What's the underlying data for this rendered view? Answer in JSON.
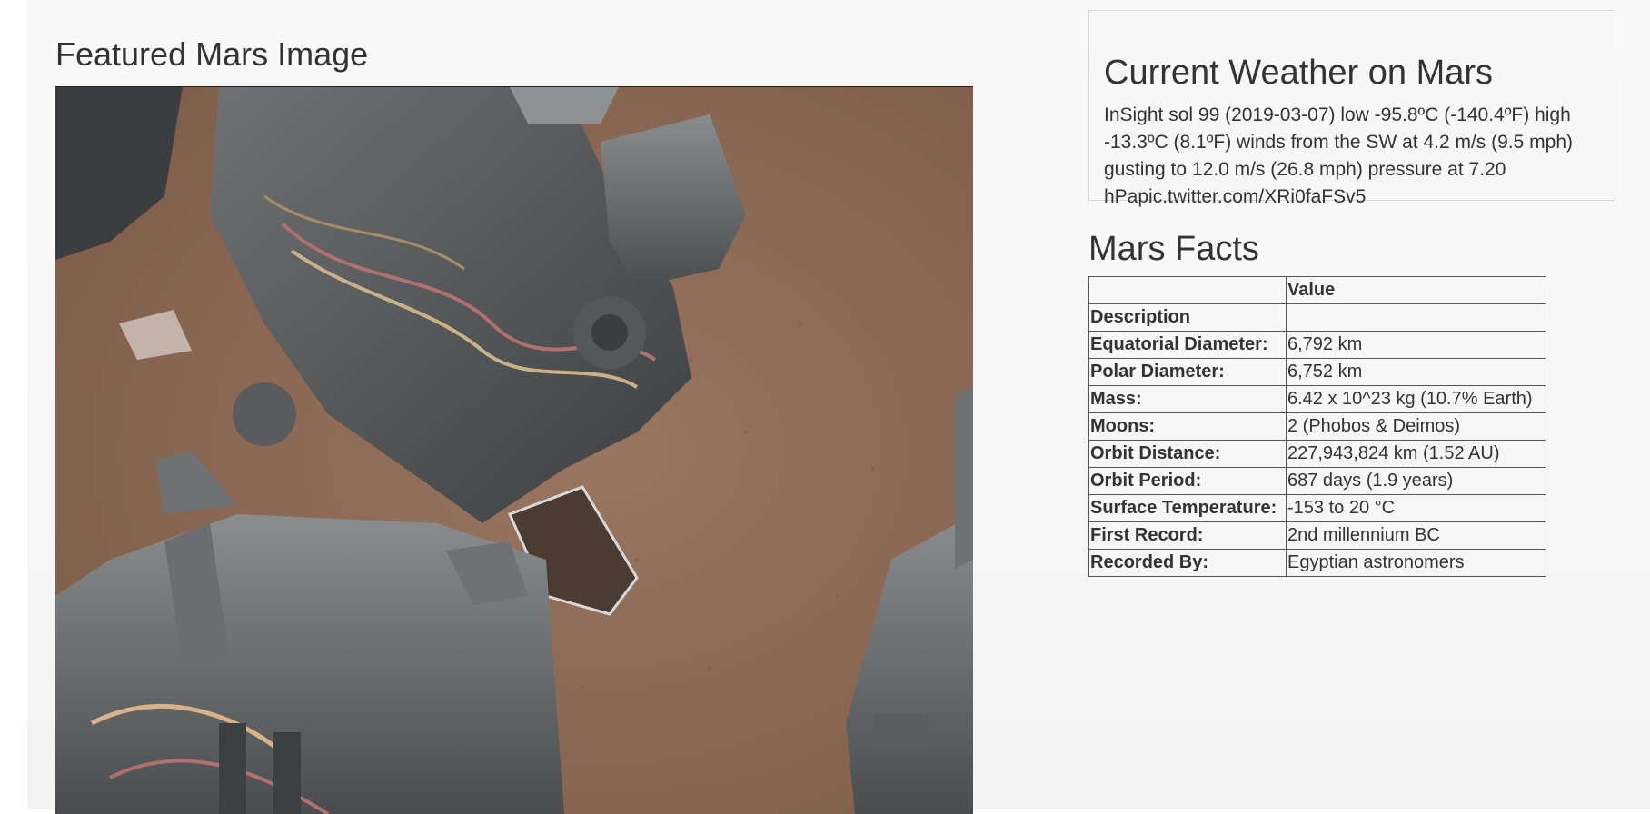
{
  "featured": {
    "title": "Featured Mars Image"
  },
  "weather": {
    "title": "Current Weather on Mars",
    "text": "InSight sol 99 (2019-03-07) low -95.8ºC (-140.4ºF) high -13.3ºC (8.1ºF) winds from the SW at 4.2 m/s (9.5 mph) gusting to 12.0 m/s (26.8 mph) pressure at 7.20 hPapic.twitter.com/XRi0faFSv5"
  },
  "facts": {
    "title": "Mars Facts",
    "header": [
      "",
      "Value"
    ],
    "index_label": "Description",
    "rows": [
      {
        "label": "Equatorial Diameter:",
        "value": "6,792 km"
      },
      {
        "label": "Polar Diameter:",
        "value": "6,752 km"
      },
      {
        "label": "Mass:",
        "value": "6.42 x 10^23 kg (10.7% Earth)"
      },
      {
        "label": "Moons:",
        "value": "2 (Phobos & Deimos)"
      },
      {
        "label": "Orbit Distance:",
        "value": "227,943,824 km (1.52 AU)"
      },
      {
        "label": "Orbit Period:",
        "value": "687 days (1.9 years)"
      },
      {
        "label": "Surface Temperature:",
        "value": "-153 to 20 °C"
      },
      {
        "label": "First Record:",
        "value": "2nd millennium BC"
      },
      {
        "label": "Recorded By:",
        "value": "Egyptian astronomers"
      }
    ]
  }
}
